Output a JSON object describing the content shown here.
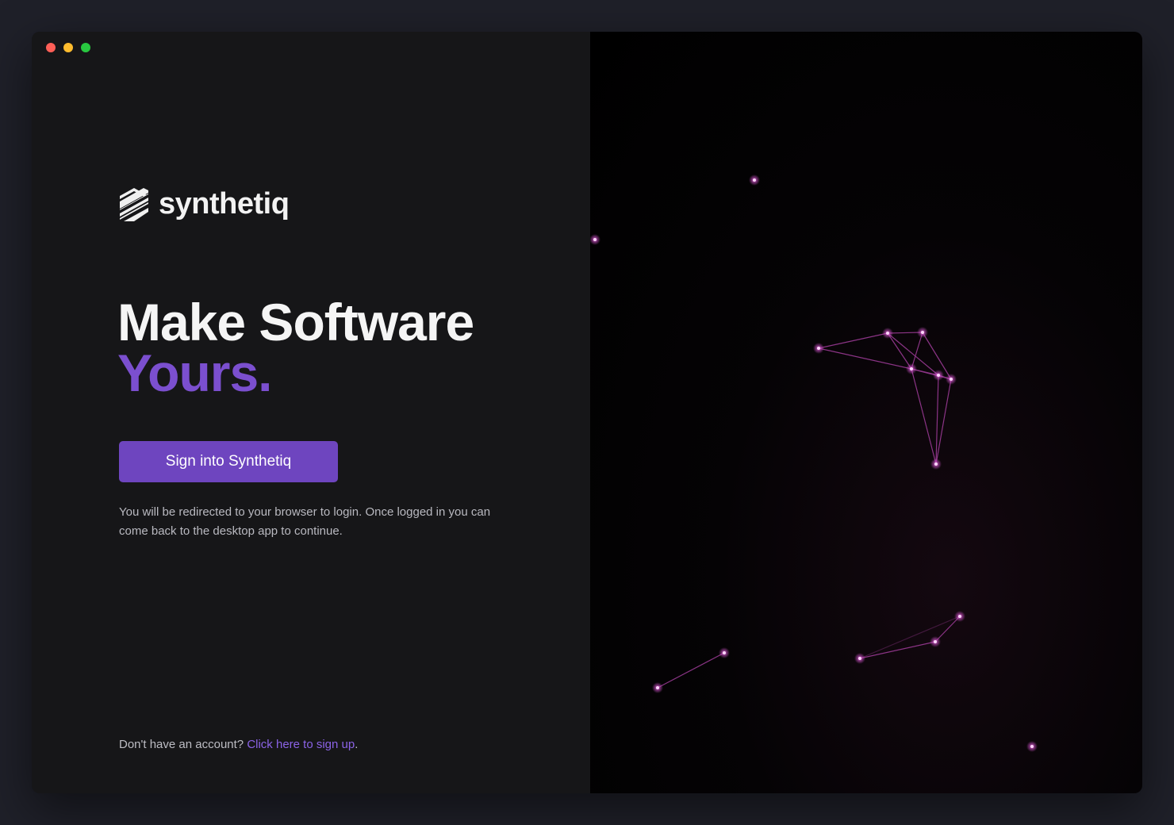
{
  "app": {
    "logo_text": "synthetiq"
  },
  "hero": {
    "line1": "Make Software",
    "line2": "Yours."
  },
  "actions": {
    "signin_label": "Sign into Synthetiq"
  },
  "note": "You will be redirected to your browser to login. Once logged in you can come back to the desktop app to continue.",
  "signup": {
    "prompt": "Don't have an account?",
    "link_text": "Click here to sign up",
    "suffix": "."
  },
  "colors": {
    "accent": "#6e45bf",
    "accent_text": "#7b4fcf",
    "link": "#8b63e6",
    "node": "#e070e0"
  }
}
